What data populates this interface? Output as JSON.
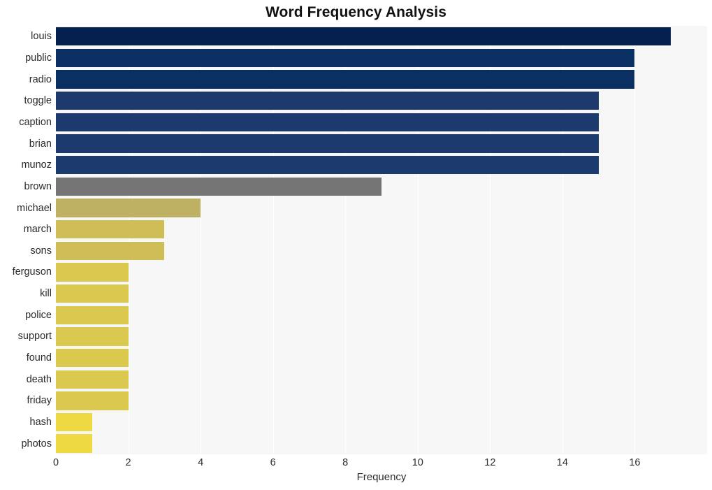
{
  "chart_data": {
    "type": "bar",
    "orientation": "horizontal",
    "title": "Word Frequency Analysis",
    "xlabel": "Frequency",
    "ylabel": "",
    "categories": [
      "louis",
      "public",
      "radio",
      "toggle",
      "caption",
      "brian",
      "munoz",
      "brown",
      "michael",
      "march",
      "sons",
      "ferguson",
      "kill",
      "police",
      "support",
      "found",
      "death",
      "friday",
      "hash",
      "photos"
    ],
    "values": [
      17,
      16,
      16,
      15,
      15,
      15,
      15,
      9,
      4,
      3,
      3,
      2,
      2,
      2,
      2,
      2,
      2,
      2,
      1,
      1
    ],
    "bar_colors": [
      "#04204f",
      "#0a2f63",
      "#0a2f63",
      "#1d3a6e",
      "#1d3a6e",
      "#1d3a6e",
      "#1d3a6e",
      "#757575",
      "#bfb164",
      "#cfbe57",
      "#cfbe57",
      "#dbc84e",
      "#dbc84e",
      "#dbc84e",
      "#dbc84e",
      "#dbc84e",
      "#dbc84e",
      "#dbc84e",
      "#efd943",
      "#efd943"
    ],
    "xticks": [
      0,
      2,
      4,
      6,
      8,
      10,
      12,
      14,
      16
    ],
    "xtick_labels": [
      "0",
      "2",
      "4",
      "6",
      "8",
      "10",
      "12",
      "14",
      "16"
    ],
    "xlim": [
      0,
      18
    ],
    "grid": true,
    "grid_color": "#ffffff",
    "plot_background": "#f7f7f7",
    "figure_background": "#ffffff",
    "legend": null
  }
}
